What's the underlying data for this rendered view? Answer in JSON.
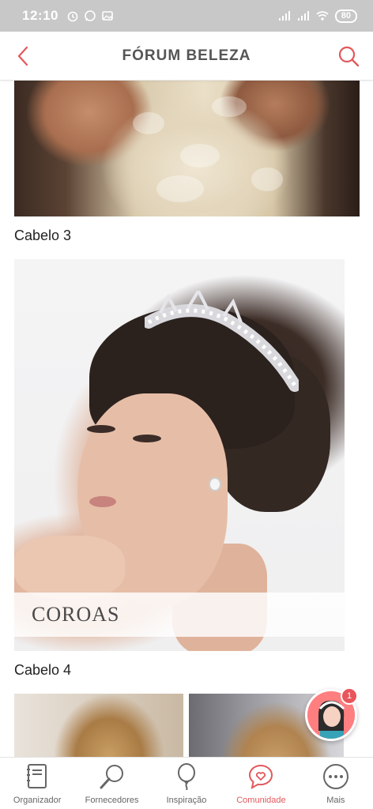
{
  "status_bar": {
    "time": "12:10",
    "battery": "80"
  },
  "header": {
    "title": "FÓRUM BELEZA"
  },
  "posts": [
    {
      "caption": "Cabelo 3"
    },
    {
      "caption": "Cabelo 4",
      "overlay_label": "COROAS"
    }
  ],
  "notification": {
    "count": "1"
  },
  "bottom_nav": {
    "items": [
      {
        "label": "Organizador",
        "icon": "notebook-icon"
      },
      {
        "label": "Fornecedores",
        "icon": "magnifier-icon"
      },
      {
        "label": "Inspiração",
        "icon": "balloon-icon"
      },
      {
        "label": "Comunidade",
        "icon": "chat-heart-icon"
      },
      {
        "label": "Mais",
        "icon": "more-dots-icon"
      }
    ]
  },
  "colors": {
    "accent": "#e2585d",
    "status_bar": "#c8c8c8"
  }
}
